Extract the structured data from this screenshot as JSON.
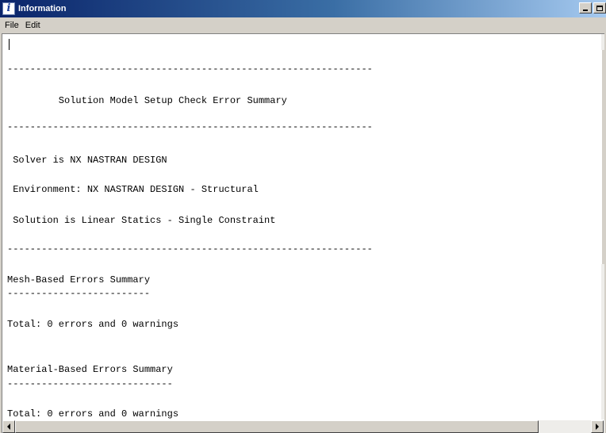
{
  "window": {
    "title": "Information",
    "icon": "info-icon",
    "icon_glyph": "i"
  },
  "menu": {
    "items": [
      "File",
      "Edit"
    ]
  },
  "content": {
    "lines": [
      "----------------------------------------------------------------",
      "         Solution Model Setup Check Error Summary",
      "----------------------------------------------------------------",
      " Solver is NX NASTRAN DESIGN",
      " Environment: NX NASTRAN DESIGN - Structural",
      " Solution is Linear Statics - Single Constraint",
      "----------------------------------------------------------------",
      "Mesh-Based Errors Summary",
      "-------------------------",
      "Total: 0 errors and 0 warnings",
      "Material-Based Errors Summary",
      "-----------------------------",
      "Total: 0 errors and 0 warnings"
    ]
  },
  "colors": {
    "titlebar_start": "#0a246a",
    "titlebar_end": "#a6caf0",
    "window_face": "#d4d0c8"
  }
}
